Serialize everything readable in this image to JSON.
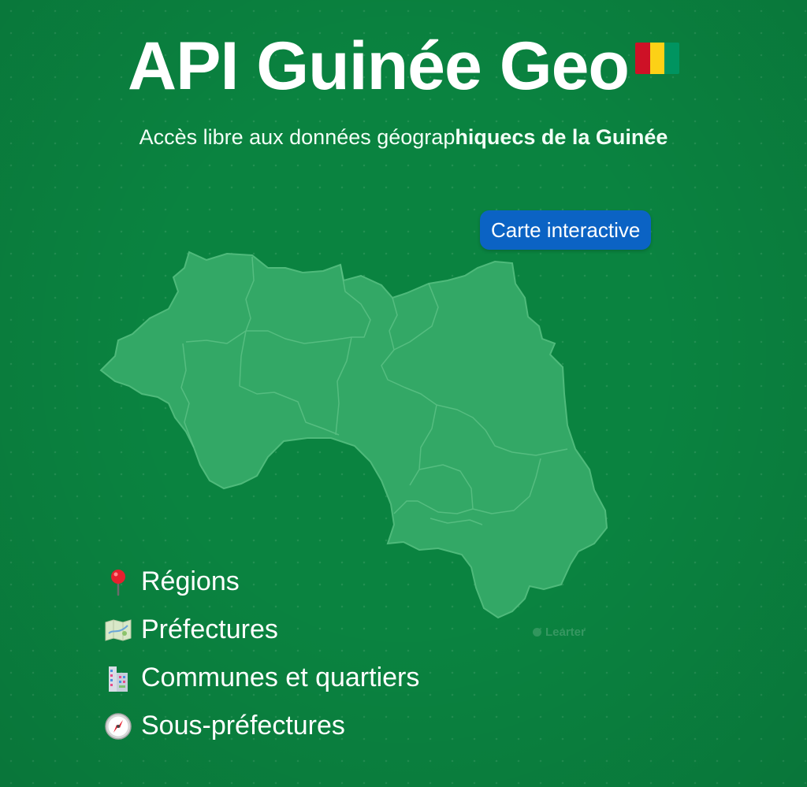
{
  "header": {
    "title": "API Guinée Geo",
    "subtitle_regular": "Accès libre aux données géograp",
    "subtitle_bold": "hiquecs de la Guinée",
    "flag_colors": [
      "#ce1126",
      "#fcd116",
      "#009460"
    ]
  },
  "badge": {
    "label": "Carte interactive",
    "color": "#0b63c4"
  },
  "map": {
    "fill_color": "#33a866",
    "border_color": "#5cc185",
    "watermark": "Learter"
  },
  "features": [
    {
      "icon": "pin-icon",
      "label": "Régions"
    },
    {
      "icon": "map-icon",
      "label": "Préfectures"
    },
    {
      "icon": "buildings-icon",
      "label": "Communes et quartiers"
    },
    {
      "icon": "compass-icon",
      "label": "Sous-préfectures"
    }
  ],
  "colors": {
    "background": "#0a8340",
    "text": "#ffffff"
  }
}
